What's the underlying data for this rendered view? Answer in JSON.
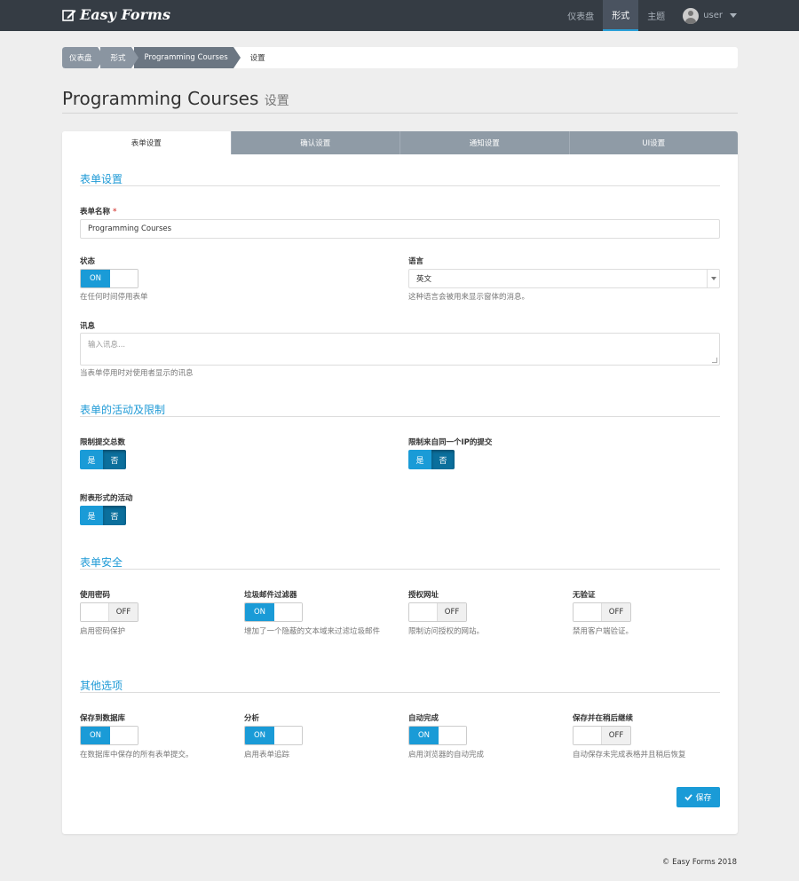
{
  "nav": {
    "brand": "Easy Forms",
    "links": [
      "仪表盘",
      "形式",
      "主题"
    ],
    "user": "user"
  },
  "breadcrumb": {
    "items": [
      "仪表盘",
      "形式",
      "Programming Courses"
    ],
    "current": "设置"
  },
  "page": {
    "title": "Programming Courses",
    "subtitle": "设置"
  },
  "tabs": [
    "表单设置",
    "确认设置",
    "通知设置",
    "UI设置"
  ],
  "form_settings": {
    "section": "表单设置",
    "name_label": "表单名称",
    "name_required": "*",
    "name_value": "Programming Courses",
    "status_label": "状态",
    "status_on": "ON",
    "status_help": "在任何时间停用表单",
    "language_label": "语言",
    "language_value": "英文",
    "language_help": "这种语言会被用来显示窗体的消息。",
    "message_label": "讯息",
    "message_placeholder": "输入讯息...",
    "message_help": "当表单停用时对使用者显示的讯息"
  },
  "activity": {
    "section": "表单的活动及限制",
    "limit_total_label": "限制提交总数",
    "limit_ip_label": "限制来自同一个IP的提交",
    "schedule_label": "附表形式的活动",
    "yes": "是",
    "no": "否"
  },
  "security": {
    "section": "表单安全",
    "items": [
      {
        "label": "使用密码",
        "state": "OFF",
        "help": "启用密码保护"
      },
      {
        "label": "垃圾邮件过滤器",
        "state": "ON",
        "help": "增加了一个隐蔽的文本域来过滤垃圾邮件"
      },
      {
        "label": "授权网址",
        "state": "OFF",
        "help": "限制访问授权的网站。"
      },
      {
        "label": "无验证",
        "state": "OFF",
        "help": "禁用客户端验证。"
      }
    ]
  },
  "other": {
    "section": "其他选项",
    "items": [
      {
        "label": "保存到数据库",
        "state": "ON",
        "help": "在数据库中保存的所有表单提交。"
      },
      {
        "label": "分析",
        "state": "ON",
        "help": "启用表单追踪"
      },
      {
        "label": "自动完成",
        "state": "ON",
        "help": "启用浏览器的自动完成"
      },
      {
        "label": "保存并在稍后继续",
        "state": "OFF",
        "help": "自动保存未完成表格并且稍后恢复"
      }
    ]
  },
  "save_label": "保存",
  "footer": "© Easy Forms 2018",
  "colors": {
    "accent": "#1a9bd7",
    "navbar": "#353c44",
    "tab_inactive": "#8f9ba6"
  }
}
